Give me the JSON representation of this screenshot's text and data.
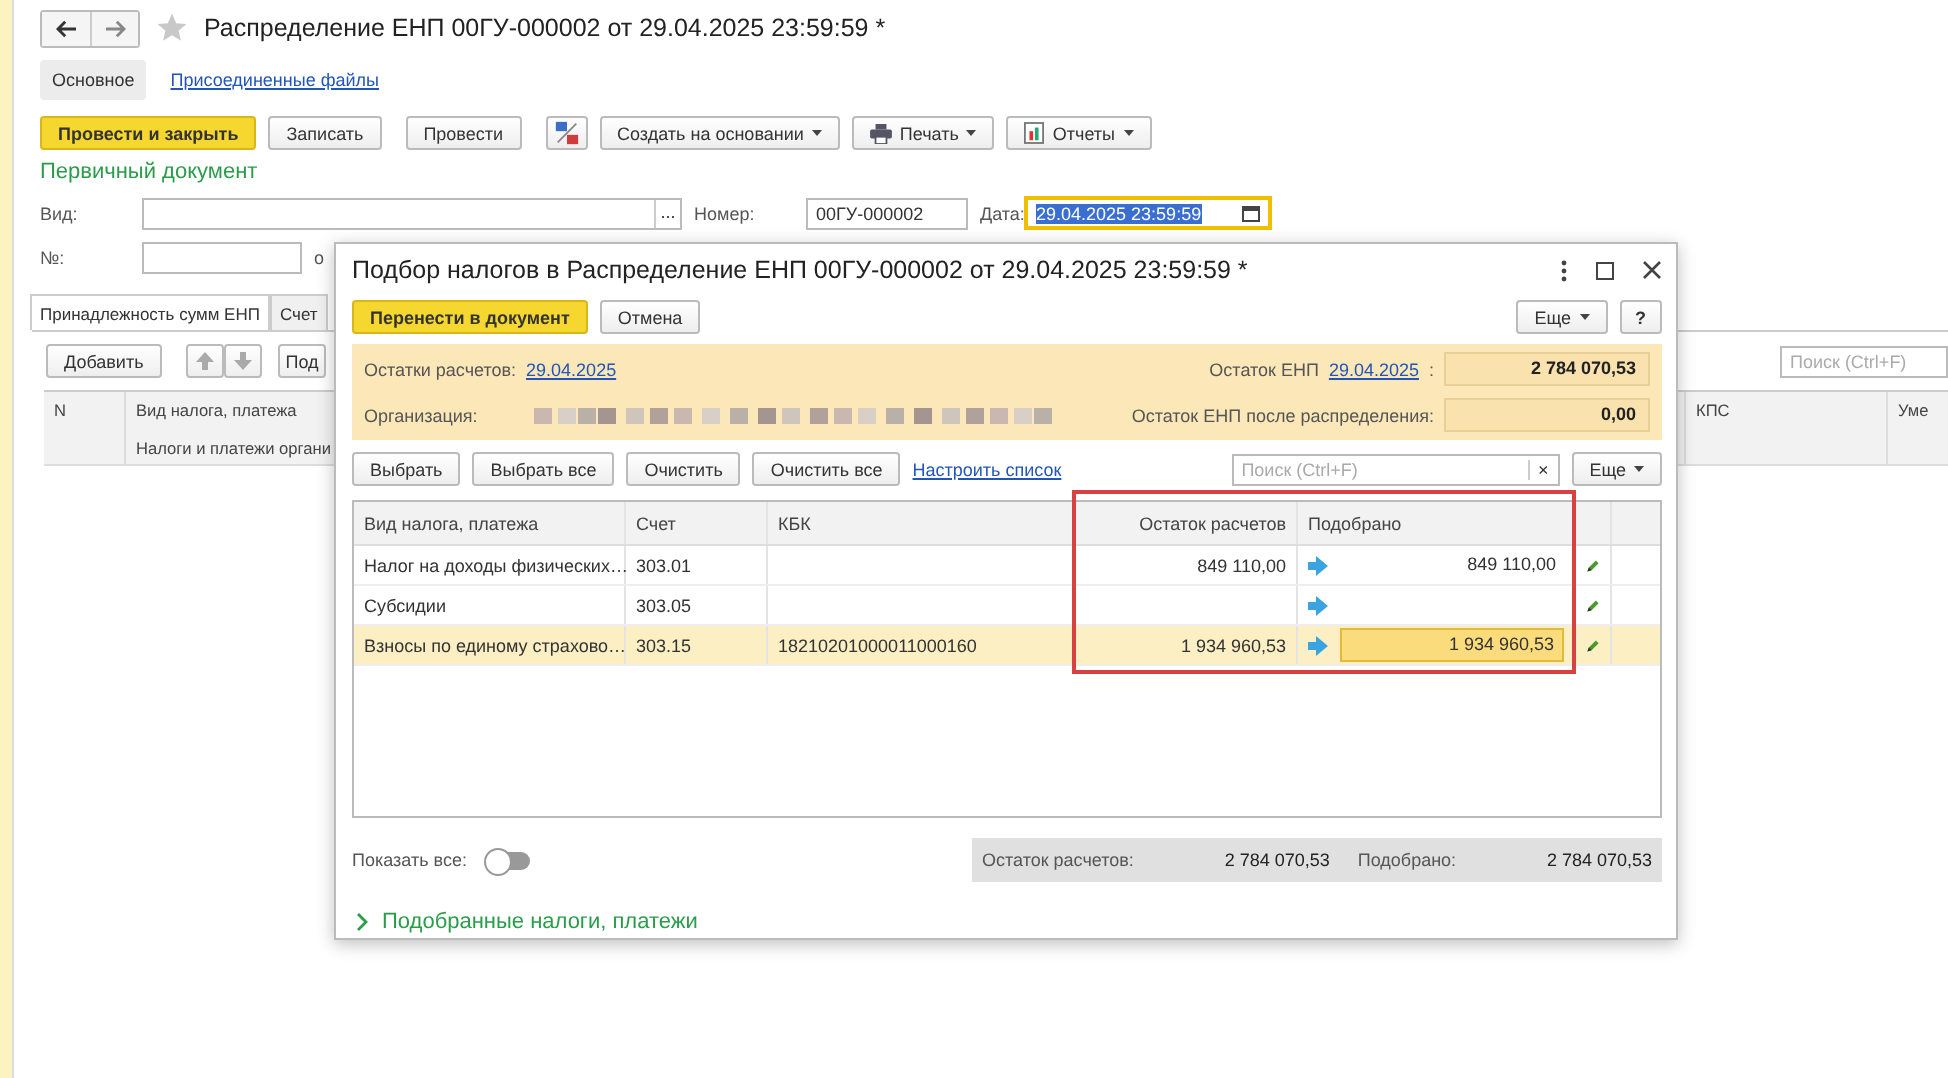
{
  "window": {
    "title": "Распределение ЕНП 00ГУ-000002 от 29.04.2025 23:59:59 *"
  },
  "tabs": [
    {
      "label": "Основное",
      "selected": true
    },
    {
      "label": "Присоединенные файлы",
      "selected": false
    }
  ],
  "toolbar": [
    {
      "kind": "primary",
      "label": "Провести и закрыть"
    },
    {
      "kind": "plain",
      "label": "Записать"
    },
    {
      "kind": "plain",
      "label": "Провести"
    },
    {
      "kind": "dtkt"
    },
    {
      "kind": "menu",
      "label": "Создать на основании"
    },
    {
      "kind": "print",
      "label": "Печать"
    },
    {
      "kind": "report",
      "label": "Отчеты"
    }
  ],
  "section_title": "Первичный документ",
  "fields": {
    "vid_label": "Вид:",
    "choose_button": "...",
    "number_label": "Номер:",
    "number": "00ГУ-000002",
    "date_label": "Дата:",
    "date": "29.04.2025 23:59:59",
    "date_focused": true,
    "no_label": "№:",
    "from_label": "о"
  },
  "inner_tabs": [
    {
      "label": "Принадлежность сумм ЕНП",
      "selected": true
    },
    {
      "label": "Счет",
      "selected": false
    }
  ],
  "table_toolbar": {
    "add": "Добавить",
    "cut_button": "Под",
    "search_placeholder": "Поиск (Ctrl+F)"
  },
  "table": {
    "col_n": "N",
    "col_kind": "Вид налога, платежа",
    "col_kind_sub": "Налоги и платежи органи",
    "col_kps": "КПС",
    "col_last": "Уме"
  },
  "dialog": {
    "title": "Подбор налогов в Распределение ЕНП 00ГУ-000002 от 29.04.2025 23:59:59 *",
    "transfer": "Перенести в документ",
    "cancel": "Отмена",
    "more": "Еще",
    "help": "?",
    "balances_label": "Остатки расчетов:",
    "balances_date": "29.04.2025",
    "org_label": "Организация:",
    "enp_label": "Остаток ЕНП",
    "enp_date": "29.04.2025",
    "enp_colon": ":",
    "enp_value": "2 784 070,53",
    "after_label": "Остаток ЕНП после распределения:",
    "after_value": "0,00",
    "actions": [
      "Выбрать",
      "Выбрать все",
      "Очистить",
      "Очистить все"
    ],
    "configure": "Настроить список",
    "search_placeholder": "Поиск (Ctrl+F)",
    "search_clear": "×",
    "more2": "Еще",
    "columns": [
      "Вид налога, платежа",
      "Счет",
      "КБК",
      "Остаток расчетов",
      "Подобрано"
    ],
    "rows": [
      {
        "kind_name": "Налог на доходы физических…",
        "account": "303.01",
        "kbk": "",
        "balance": "849 110,00",
        "picked": "849 110,00",
        "selected": false
      },
      {
        "kind_name": "Субсидии",
        "account": "303.05",
        "kbk": "",
        "balance": "",
        "picked": "",
        "selected": false
      },
      {
        "kind_name": "Взносы по единому страхово…",
        "account": "303.15",
        "kbk": "18210201000011000160",
        "balance": "1 934 960,53",
        "picked": "1 934 960,53",
        "selected": true
      }
    ],
    "show_all_label": "Показать все:",
    "show_all_on": false,
    "total_balance_label": "Остаток расчетов:",
    "total_balance": "2 784 070,53",
    "total_picked_label": "Подобрано:",
    "total_picked": "2 784 070,53",
    "picked_section": {
      "label": "Подобранные налоги, платежи",
      "expanded": false
    }
  }
}
